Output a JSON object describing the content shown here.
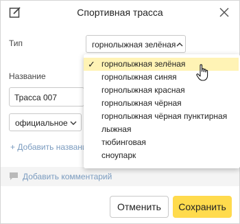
{
  "dialog": {
    "title": "Спортивная трасса",
    "icons": {
      "edit": "edit-icon",
      "close": "close-icon"
    }
  },
  "form": {
    "type_label": "Тип",
    "type_value": "горнолыжная зелёная",
    "name_label": "Название",
    "name_value": "Трасса 007",
    "kind_value": "официальное",
    "add_name": "+ Добавить названи"
  },
  "dropdown": {
    "check_glyph": "✓",
    "options": [
      "горнолыжная зелёная",
      "горнолыжная синяя",
      "горнолыжная красная",
      "горнолыжная чёрная",
      "горнолыжная чёрная пунктирная",
      "лыжная",
      "тюбинговая",
      "сноупарк"
    ]
  },
  "comment": {
    "label": "Добавить комментарий",
    "icon": "comment-icon"
  },
  "buttons": {
    "cancel": "Отменить",
    "save": "Сохранить"
  },
  "colors": {
    "accent": "#ffdb4d",
    "selected_bg": "#fff3b5",
    "link": "#7a9bbf"
  }
}
